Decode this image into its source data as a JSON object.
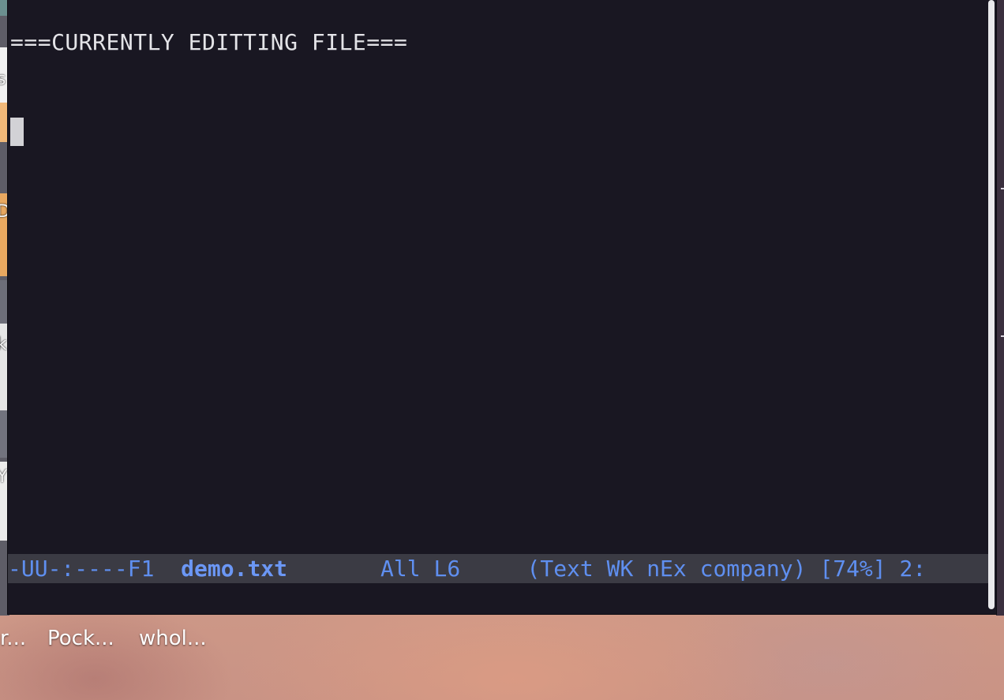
{
  "editor": {
    "buffer_lines": [
      "===CURRENTLY EDITTING FILE===",
      "",
      ""
    ],
    "mode_line": {
      "status": "-UU-:----F1",
      "buffer_name": "demo.txt",
      "position": "All L6",
      "modes": "(Text WK nEx company)",
      "percent": "[74%]",
      "column": "2:"
    },
    "colors": {
      "background": "#191722",
      "foreground": "#e4e4e8",
      "mode_line_bg": "#3b3b44",
      "mode_line_fg": "#5f8ff0"
    }
  },
  "desktop": {
    "left_edge_letters": [
      "s",
      "D",
      "k",
      "Y"
    ],
    "icon_labels": [
      "r...",
      "Pock...",
      "whol..."
    ]
  }
}
